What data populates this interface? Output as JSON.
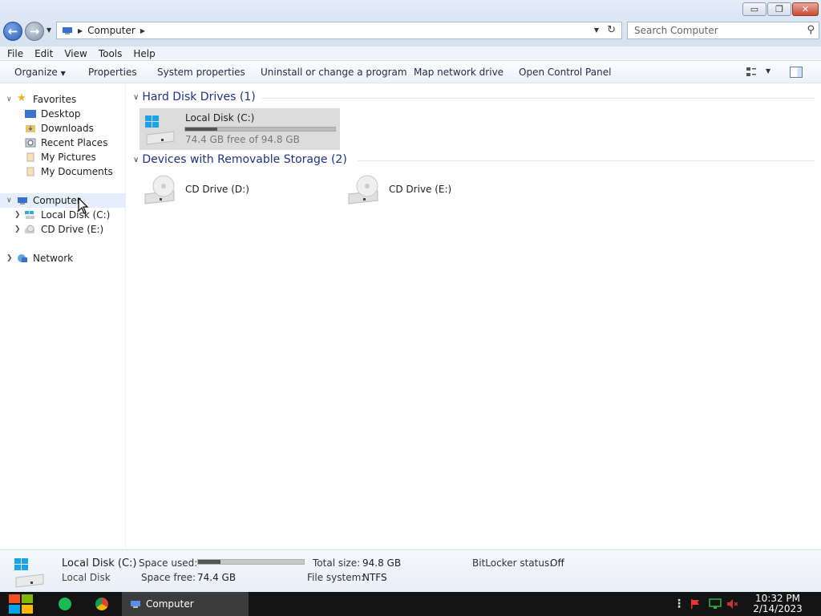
{
  "window": {
    "title": "Computer"
  },
  "titlebar": {
    "min_glyph": "▭",
    "max_glyph": "❐",
    "close_glyph": "✕"
  },
  "nav": {
    "back_glyph": "←",
    "forward_glyph": "→",
    "address": {
      "location": "Computer"
    },
    "search": {
      "placeholder": "Search Computer"
    }
  },
  "menu": [
    "File",
    "Edit",
    "View",
    "Tools",
    "Help"
  ],
  "commands": {
    "organize": "Organize",
    "properties": "Properties",
    "system_properties": "System properties",
    "uninstall": "Uninstall or change a program",
    "map_drive": "Map network drive",
    "control_panel": "Open Control Panel"
  },
  "sidebar": {
    "favorites": {
      "label": "Favorites",
      "items": [
        "Desktop",
        "Downloads",
        "Recent Places",
        "My Pictures",
        "My Documents"
      ]
    },
    "computer": {
      "label": "Computer",
      "items": [
        "Local Disk (C:)",
        "CD Drive (E:)"
      ]
    },
    "network": {
      "label": "Network"
    }
  },
  "groups": {
    "hard_disks": {
      "title": "Hard Disk Drives (1)"
    },
    "removable": {
      "title": "Devices with Removable Storage (2)"
    }
  },
  "drives": {
    "c": {
      "name": "Local Disk (C:)",
      "free_text": "74.4 GB free of 94.8 GB",
      "used_fraction": 0.215
    },
    "d": {
      "name": "CD Drive (D:)"
    },
    "e": {
      "name": "CD Drive (E:)"
    }
  },
  "details": {
    "name": "Local Disk (C:)",
    "type": "Local Disk",
    "space_used_label": "Space used:",
    "space_free_label": "Space free:",
    "space_free_value": "74.4 GB",
    "total_size_label": "Total size:",
    "total_size_value": "94.8 GB",
    "file_system_label": "File system:",
    "file_system_value": "NTFS",
    "bitlocker_label": "BitLocker status:",
    "bitlocker_value": "Off",
    "used_fraction": 0.215
  },
  "taskbar": {
    "active_window": "Computer",
    "time": "10:32 PM",
    "date": "2/14/2023"
  },
  "colors": {
    "accent": "#1e3287",
    "selection": "#e5eefb",
    "taskbar": "#141414"
  }
}
